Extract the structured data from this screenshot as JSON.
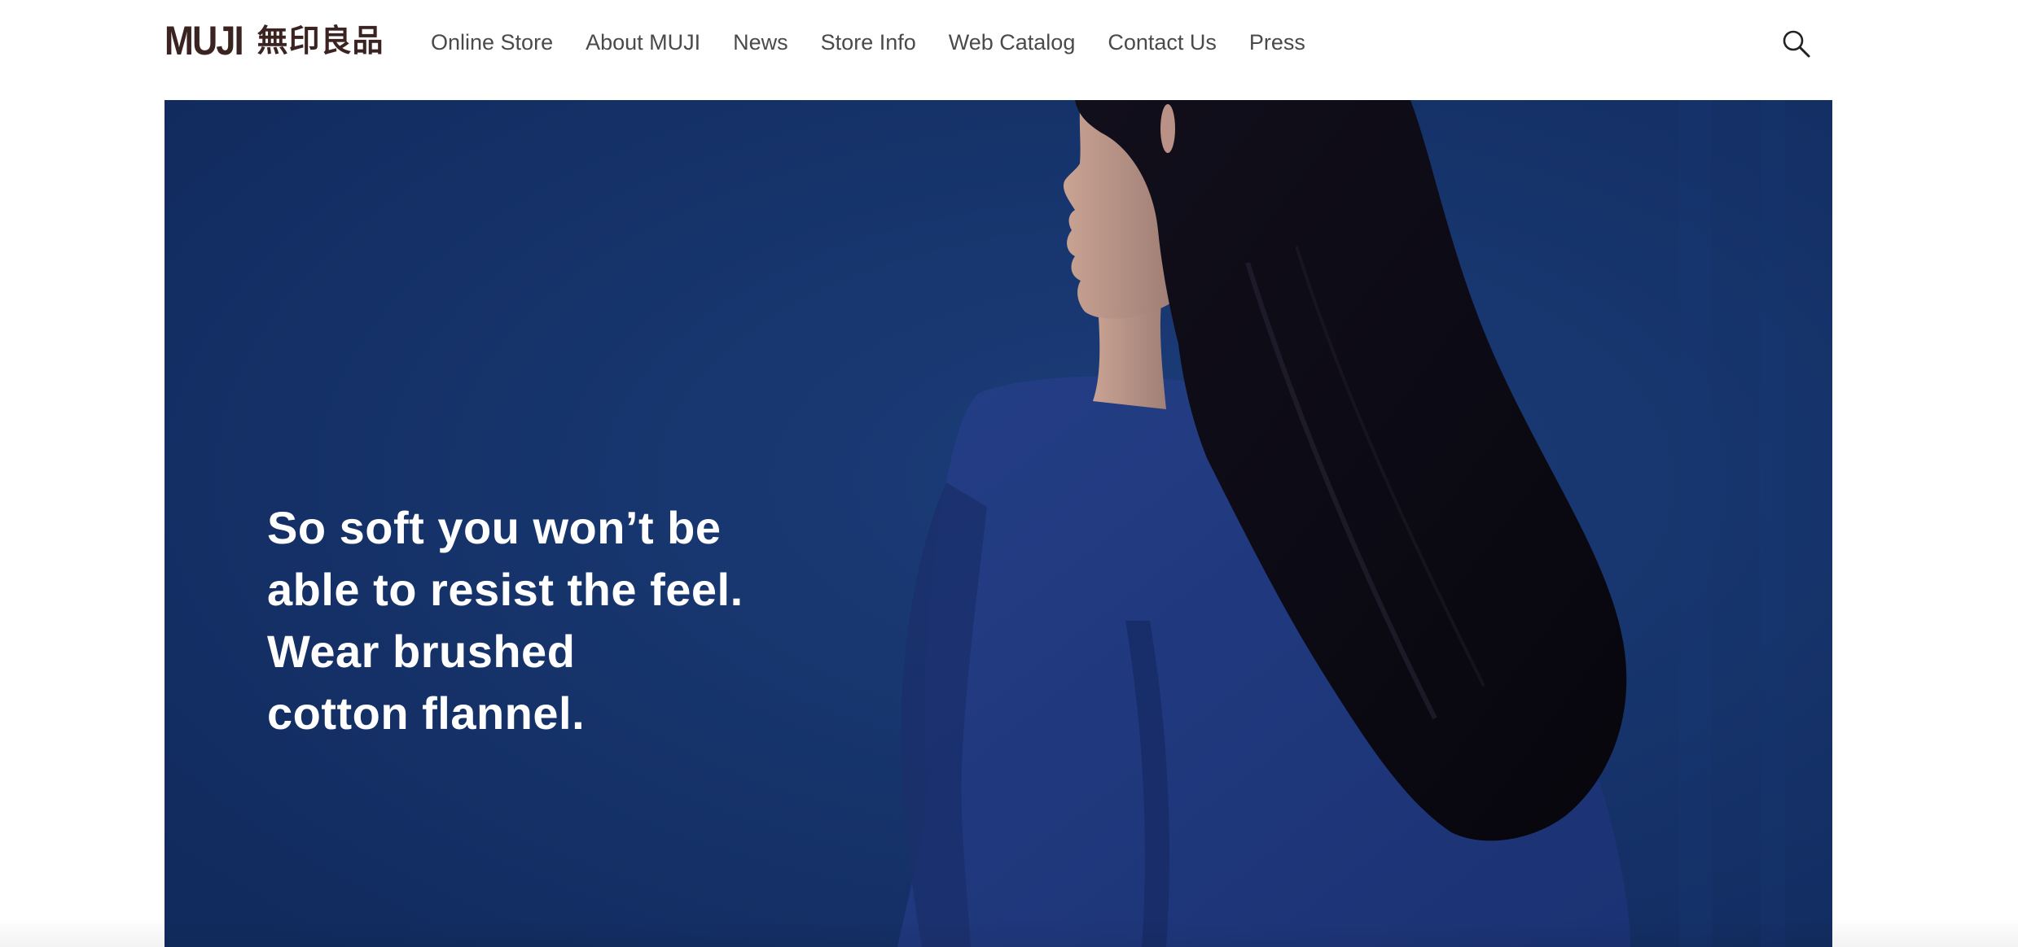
{
  "brand": {
    "name_latin": "MUJI",
    "name_japanese": "無印良品",
    "color": "#3a2320"
  },
  "nav": {
    "items": [
      {
        "label": "Online Store"
      },
      {
        "label": "About MUJI"
      },
      {
        "label": "News"
      },
      {
        "label": "Store Info"
      },
      {
        "label": "Web Catalog"
      },
      {
        "label": "Contact Us"
      },
      {
        "label": "Press"
      }
    ],
    "text_color": "#4a4a4a"
  },
  "search": {
    "icon": "search-icon"
  },
  "hero": {
    "headline_lines": [
      "So soft you won’t be",
      "able to resist the feel.",
      "Wear brushed",
      "cotton flannel."
    ],
    "background_color": "#18336a",
    "text_color": "#ffffff"
  }
}
